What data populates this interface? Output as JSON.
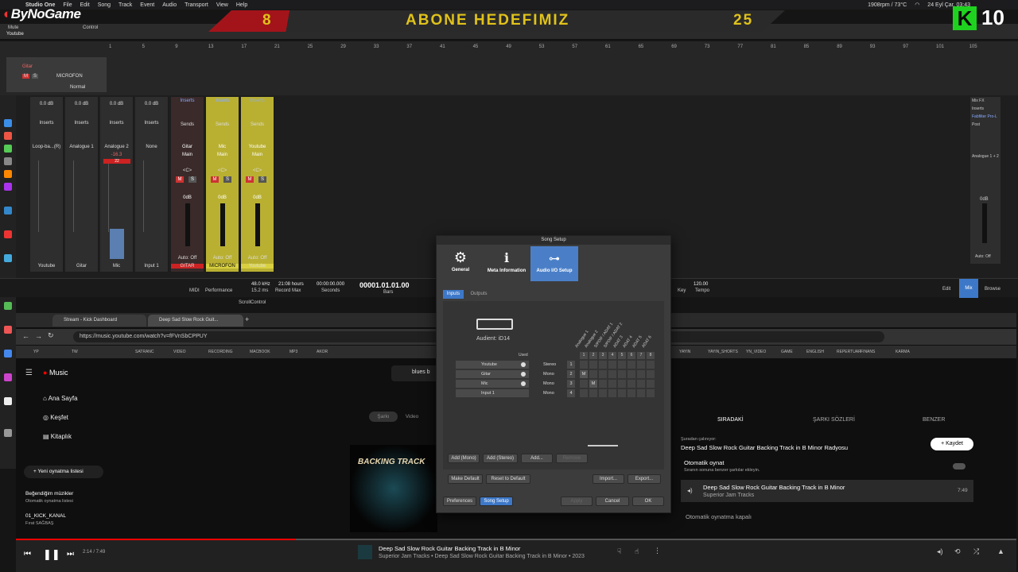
{
  "menubar": {
    "app": "Studio One",
    "items": [
      "File",
      "Edit",
      "Song",
      "Track",
      "Event",
      "Audio",
      "Transport",
      "View",
      "Help"
    ],
    "status": "1908rpm / 73°C",
    "datetime": "24 Eyl Çar. 03:43"
  },
  "overlay": {
    "brand": "ByNoGame",
    "banner_left": "8",
    "banner_text": "ABONE HEDEFIMIZ",
    "banner_right": "25",
    "k_letter": "K",
    "k_count": "10"
  },
  "daw": {
    "top_labels": [
      "Mute",
      "Control"
    ],
    "track_select": "Youtube",
    "ruler": [
      "1",
      "5",
      "9",
      "13",
      "17",
      "21",
      "25",
      "29",
      "33",
      "37",
      "41",
      "45",
      "49",
      "53",
      "57",
      "61",
      "65",
      "69",
      "73",
      "77",
      "81",
      "85",
      "89",
      "93",
      "97",
      "101",
      "105"
    ],
    "track_name": "Gitar",
    "track_label": "MICROFON",
    "track_mode": "Normal",
    "strips": [
      {
        "name": "Loop-ba...(R)",
        "vol": "0.0 dB",
        "bottom": "Youtube"
      },
      {
        "name": "Analogue 1",
        "vol": "0.0 dB",
        "bottom": "Gitar"
      },
      {
        "name": "Analogue 2",
        "vol": "0.0 dB",
        "bottom": "Mic",
        "meter": "-16.3",
        "peak": "22"
      },
      {
        "name": "None",
        "vol": "0.0 dB",
        "bottom": "Input 1"
      },
      {
        "name": "Gitar",
        "route": "Main",
        "vol": "0dB",
        "bottom": "GITAR"
      },
      {
        "name": "Mic",
        "route": "Main",
        "vol": "0dB",
        "bottom": "MICROFON"
      },
      {
        "name": "Youtube",
        "route": "Main",
        "vol": "0dB",
        "bottom": "Youtube"
      }
    ],
    "strip_labels": {
      "inserts": "Inserts",
      "sends": "Sends",
      "auto": "Auto: Off",
      "mono": "Mono",
      "tune": "Tune",
      "plugin": "Schepa Onc",
      "input": "TH U",
      "center": "<C>"
    },
    "right_strip": {
      "label1": "Mix FX",
      "label2": "Inserts",
      "label3": "Fabfilter Pro-L",
      "label4": "Post",
      "label5": "Inserts",
      "name": "Analogue 1 + 2",
      "vol": "0dB",
      "auto": "Auto: Off",
      "main": "Main"
    },
    "transport": {
      "midi": "MIDI",
      "performance": "Performance",
      "sample_rate": "48.0 kHz",
      "bit": "15.2 ms",
      "record_time": "21:08 hours",
      "record_max": "Record Max",
      "time": "00:00:00.000",
      "seconds": "Seconds",
      "bars_pos": "00001.01.01.00",
      "bars": "Bars",
      "key": "Key",
      "tempo": "120.00",
      "tempo_label": "Tempo",
      "edit": "Edit",
      "mix": "Mix",
      "browse": "Browse",
      "scroll": "ScrollControl"
    }
  },
  "dialog": {
    "title": "Song Setup",
    "tabs": [
      "General",
      "Meta Information",
      "Audio I/O Setup"
    ],
    "subtabs": [
      "Inputs",
      "Outputs"
    ],
    "device": "Audient: iD14",
    "used_label": "Used",
    "channels": [
      "Analogue 1",
      "Analogue 2",
      "S/PDIF / ADAT 1",
      "S/PDIF / ADAT 2",
      "ADAT 3",
      "ADAT 4",
      "ADAT 5",
      "ADAT 6"
    ],
    "channel_nums": [
      "1",
      "2",
      "3",
      "4",
      "5",
      "6",
      "7",
      "8"
    ],
    "rows": [
      {
        "name": "Youtube",
        "type": "Stereo",
        "num": "1",
        "mark": ""
      },
      {
        "name": "Gitar",
        "type": "Mono",
        "num": "2",
        "mark": "M"
      },
      {
        "name": "Mic",
        "type": "Mono",
        "num": "3",
        "mark": "M"
      },
      {
        "name": "Input 1",
        "type": "Mono",
        "num": "4",
        "mark": ""
      }
    ],
    "buttons": {
      "add_mono": "Add (Mono)",
      "add_stereo": "Add (Stereo)",
      "add": "Add...",
      "remove": "Remove",
      "make_default": "Make Default",
      "reset": "Reset to Default",
      "import": "Import...",
      "export": "Export...",
      "preferences": "Preferences",
      "song_setup": "Song Setup",
      "apply": "Apply",
      "cancel": "Cancel",
      "ok": "OK"
    }
  },
  "browser": {
    "tabs": [
      "Stream - Kick Dashboard",
      "Deep Sad Slow Rock Guit..."
    ],
    "url": "https://music.youtube.com/watch?v=fFVnSbCPPUY",
    "bookmarks": [
      "YP",
      "TW",
      "SATRANC",
      "VIDEO",
      "RECORDING",
      "MACBOOK",
      "MP3",
      "AKOR",
      "YAYIN",
      "YAYIN_SHORTS",
      "YN_VIDEO",
      "GAME",
      "ENGLISH",
      "REPERTUAR",
      "FINANS",
      "KARMA"
    ],
    "search": "blues b"
  },
  "yt": {
    "brand": "Music",
    "nav": [
      "Ana Sayfa",
      "Keşfet",
      "Kitaplık"
    ],
    "new_playlist": "Yeni oynatma listesi",
    "liked": "Beğendiğim müzikler",
    "liked_sub": "Otomatik oynatma listesi",
    "pl2": "01_KICK_KANAL",
    "pl2_sub": "Fırat SAĞBAŞ",
    "toggle": [
      "Şarkı",
      "Video"
    ],
    "art_text": "BACKING TRACK",
    "right_tabs": [
      "SIRADAKİ",
      "ŞARKI SÖZLERİ",
      "BENZER"
    ],
    "playing_from": "Şuradan çalınıyor:",
    "radio": "Deep Sad Slow Rock Guitar Backing Track in B Minor Radyosu",
    "save": "Kaydet",
    "autoplay": "Otomatik oynat",
    "autoplay_sub": "Sıranın sonuna benzer şarkılar ekleyin.",
    "queue_title": "Deep Sad Slow Rock Guitar Backing Track in B Minor",
    "queue_artist": "Superior Jam Tracks",
    "queue_time": "7:49",
    "autoplay_off": "Otomatik oynatma kapalı",
    "player_time": "2:14 / 7:49",
    "player_title": "Deep Sad Slow Rock Guitar Backing Track in B Minor",
    "player_sub": "Superior Jam Tracks • Deep Sad Slow Rock Guitar Backing Track in B Minor • 2023",
    "progress": 0.28
  }
}
